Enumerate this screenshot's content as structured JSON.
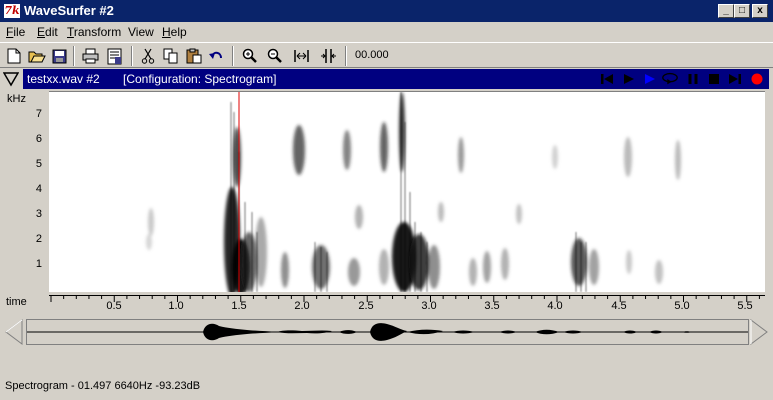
{
  "window": {
    "title": "WaveSurfer #2",
    "app_icon_text": "7k",
    "minimize_symbol": "_",
    "maximize_symbol": "□",
    "close_symbol": "x"
  },
  "menu": {
    "items": [
      {
        "label": "File",
        "mnemonic": "F",
        "rest": "ile"
      },
      {
        "label": "Edit",
        "mnemonic": "E",
        "rest": "dit"
      },
      {
        "label": "Transform",
        "mnemonic": "T",
        "rest": "ransform"
      },
      {
        "label": "View",
        "mnemonic": "",
        "rest": "View"
      },
      {
        "label": "Help",
        "mnemonic": "H",
        "rest": "elp"
      }
    ]
  },
  "toolbar": {
    "time_readout": "00.000",
    "icons": [
      "new-file-icon",
      "open-folder-icon",
      "save-icon",
      "print-icon",
      "properties-icon",
      "cut-icon",
      "copy-icon",
      "paste-icon",
      "undo-icon",
      "zoom-in-icon",
      "zoom-out-icon",
      "zoom-fit-icon",
      "zoom-selection-icon"
    ]
  },
  "pane": {
    "filename": "testxx.wav #2",
    "configuration": "[Configuration: Spectrogram]",
    "y_unit": "kHz",
    "y_ticks": [
      "7",
      "6",
      "5",
      "4",
      "3",
      "2",
      "1"
    ],
    "time_label": "time",
    "time_ticks": [
      "0.5",
      "1.0",
      "1.5",
      "2.0",
      "2.5",
      "3.0",
      "3.5",
      "4.0",
      "4.5",
      "5.0",
      "5.5"
    ],
    "cursor_time": 1.497,
    "playback_icons": [
      "rewind-to-start-icon",
      "play-icon",
      "play-selection-icon",
      "loop-play-icon",
      "pause-icon",
      "stop-icon",
      "forward-to-end-icon",
      "record-icon"
    ],
    "colors": {
      "header_bg": "#000080",
      "cursor": "#e00000",
      "record": "#ff0000",
      "play_selection": "#0000ff"
    }
  },
  "status": {
    "text": "Spectrogram - 01.497 6640Hz -93.23dB"
  }
}
